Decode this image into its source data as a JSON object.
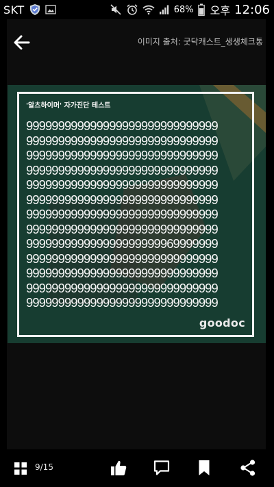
{
  "status_bar": {
    "carrier": "SKT",
    "battery_percent": "68%",
    "ampm": "오후",
    "time": "12:06",
    "icons": [
      "shield-icon",
      "gallery-icon",
      "mute-icon",
      "alarm-icon",
      "wifi-icon",
      "signal-icon",
      "battery-icon"
    ]
  },
  "top_bar": {
    "back_icon": "arrow-left-icon",
    "source_credit": "이미지 출처: 굿닥캐스트_생생체크통"
  },
  "image": {
    "title": "'알츠하이머' 자가진단 테스트",
    "rows": [
      "999999999999999999999999999999",
      "999999999999999999999999999999",
      "999999999999999999999999999999",
      "999999999999999999999999999999",
      "999999999999999999999999999999",
      "999999999999999999999999999999",
      "999999999999999999999999999999",
      "999999999999999999999999999999",
      "999999999999999999999969999999",
      "999999999999999999999999999999",
      "999999999999999999999999999999",
      "999999999999999999999999999999",
      "999999999999999999999999999999"
    ],
    "brand": "goodoc",
    "colors": {
      "background": "#173d31",
      "frame": "#f2f2f2",
      "text": "#f6f6f6"
    }
  },
  "bottom_bar": {
    "page_indicator": "9/15",
    "icons": [
      "grid-icon",
      "thumbs-up-icon",
      "comment-icon",
      "bookmark-icon",
      "share-icon"
    ]
  }
}
